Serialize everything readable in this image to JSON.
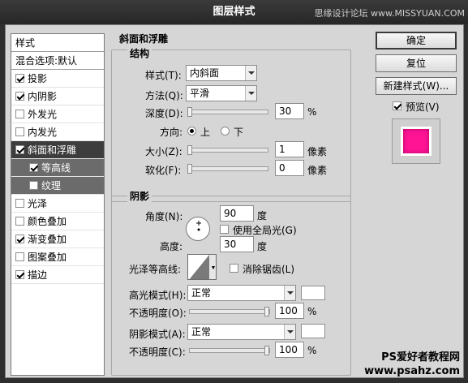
{
  "window": {
    "title": "图层样式"
  },
  "watermark": {
    "top": "思缘设计论坛 www.MISSYUAN.COM",
    "bottom_line1": "PS爱好者教程网",
    "bottom_line2": "www.psahz.com"
  },
  "style_list": {
    "header": "样式",
    "blend": "混合选项:默认",
    "items": [
      {
        "label": "投影",
        "checked": true
      },
      {
        "label": "内阴影",
        "checked": true
      },
      {
        "label": "外发光",
        "checked": false
      },
      {
        "label": "内发光",
        "checked": false
      },
      {
        "label": "斜面和浮雕",
        "checked": true,
        "selected": true
      },
      {
        "label": "等高线",
        "checked": true,
        "sub": true
      },
      {
        "label": "纹理",
        "checked": false,
        "sub": true
      },
      {
        "label": "光泽",
        "checked": false
      },
      {
        "label": "颜色叠加",
        "checked": false
      },
      {
        "label": "渐变叠加",
        "checked": true
      },
      {
        "label": "图案叠加",
        "checked": false
      },
      {
        "label": "描边",
        "checked": true
      }
    ]
  },
  "bevel": {
    "section_title": "斜面和浮雕",
    "structure_title": "结构",
    "style_label": "样式(T):",
    "style_value": "内斜面",
    "method_label": "方法(Q):",
    "method_value": "平滑",
    "depth_label": "深度(D):",
    "depth_value": "30",
    "depth_unit": "%",
    "direction_label": "方向:",
    "direction_up": "上",
    "direction_down": "下",
    "size_label": "大小(Z):",
    "size_value": "1",
    "size_unit": "像素",
    "soften_label": "软化(F):",
    "soften_value": "0",
    "soften_unit": "像素"
  },
  "shading": {
    "title": "阴影",
    "angle_label": "角度(N):",
    "angle_value": "90",
    "angle_unit": "度",
    "global_light": "使用全局光(G)",
    "altitude_label": "高度:",
    "altitude_value": "30",
    "altitude_unit": "度",
    "gloss_label": "光泽等高线:",
    "anti_alias": "消除锯齿(L)",
    "highlight_label": "高光模式(H):",
    "highlight_value": "正常",
    "highlight_opacity_label": "不透明度(O):",
    "highlight_opacity_value": "100",
    "shadow_label": "阴影模式(A):",
    "shadow_value": "正常",
    "shadow_opacity_label": "不透明度(C):",
    "shadow_opacity_value": "100",
    "percent": "%"
  },
  "buttons": {
    "ok": "确定",
    "reset": "复位",
    "new_style": "新建样式(W)...",
    "preview": "预览(V)"
  },
  "colors": {
    "preview": "#ff1493"
  }
}
